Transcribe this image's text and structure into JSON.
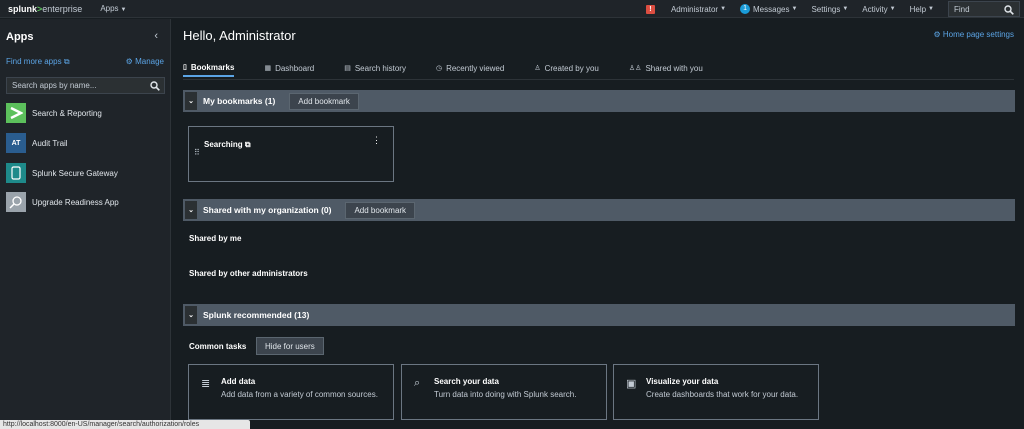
{
  "topbar": {
    "logo_part1": "splunk",
    "logo_part2": ">",
    "logo_part3": "enterprise",
    "apps_menu": "Apps",
    "alert_count": "!",
    "user_menu": "Administrator",
    "messages_count": "1",
    "messages_label": "Messages",
    "settings_label": "Settings",
    "activity_label": "Activity",
    "help_label": "Help",
    "find_placeholder": "Find",
    "icons": {
      "search": "magnifier-icon",
      "alert": "alert-icon",
      "caret": "caret-down-icon"
    }
  },
  "sidebar": {
    "title": "Apps",
    "find_more": "Find more apps",
    "manage": "Manage",
    "search_placeholder": "Search apps by name...",
    "items": [
      {
        "label": "Search & Reporting",
        "icon": "search-reporting-icon",
        "color": "#5cc05c"
      },
      {
        "label": "Audit Trail",
        "icon": "AT",
        "color": "#2a5d8f"
      },
      {
        "label": "Splunk Secure Gateway",
        "icon": "phone-icon",
        "color": "#1e8a8a"
      },
      {
        "label": "Upgrade Readiness App",
        "icon": "magnifier-app-icon",
        "color": "#9aa3ab"
      }
    ]
  },
  "main": {
    "greeting": "Hello, Administrator",
    "home_settings": "Home page settings",
    "tabs": [
      {
        "label": "Bookmarks",
        "icon": "bookmark-icon"
      },
      {
        "label": "Dashboard",
        "icon": "grid-icon"
      },
      {
        "label": "Search history",
        "icon": "history-icon"
      },
      {
        "label": "Recently viewed",
        "icon": "clock-icon"
      },
      {
        "label": "Created by you",
        "icon": "user-icon"
      },
      {
        "label": "Shared with you",
        "icon": "users-icon"
      }
    ],
    "sections": {
      "my_bookmarks": {
        "title": "My bookmarks (1)",
        "add": "Add bookmark"
      },
      "shared_org": {
        "title": "Shared with my organization (0)",
        "add": "Add bookmark"
      },
      "recommended": {
        "title": "Splunk recommended (13)"
      }
    },
    "bookmark_card": {
      "title": "Searching"
    },
    "shared_by_me": "Shared by me",
    "shared_by_other": "Shared by other administrators",
    "common_tasks": "Common tasks",
    "hide_for_users": "Hide for users",
    "task_cards": [
      {
        "title": "Add data",
        "desc": "Add data from a variety of common sources.",
        "icon": "database-icon"
      },
      {
        "title": "Search your data",
        "desc": "Turn data into doing with Splunk search.",
        "icon": "search-icon"
      },
      {
        "title": "Visualize your data",
        "desc": "Create dashboards that work for your data.",
        "icon": "visualize-icon"
      }
    ]
  },
  "statusbar": {
    "url": "http://localhost:8000/en-US/manager/search/authorization/roles"
  },
  "colors": {
    "accent": "#5ba4e5",
    "brand_green": "#5cc05c",
    "section_bar": "#4f5a66",
    "alert": "#dc4e41"
  }
}
